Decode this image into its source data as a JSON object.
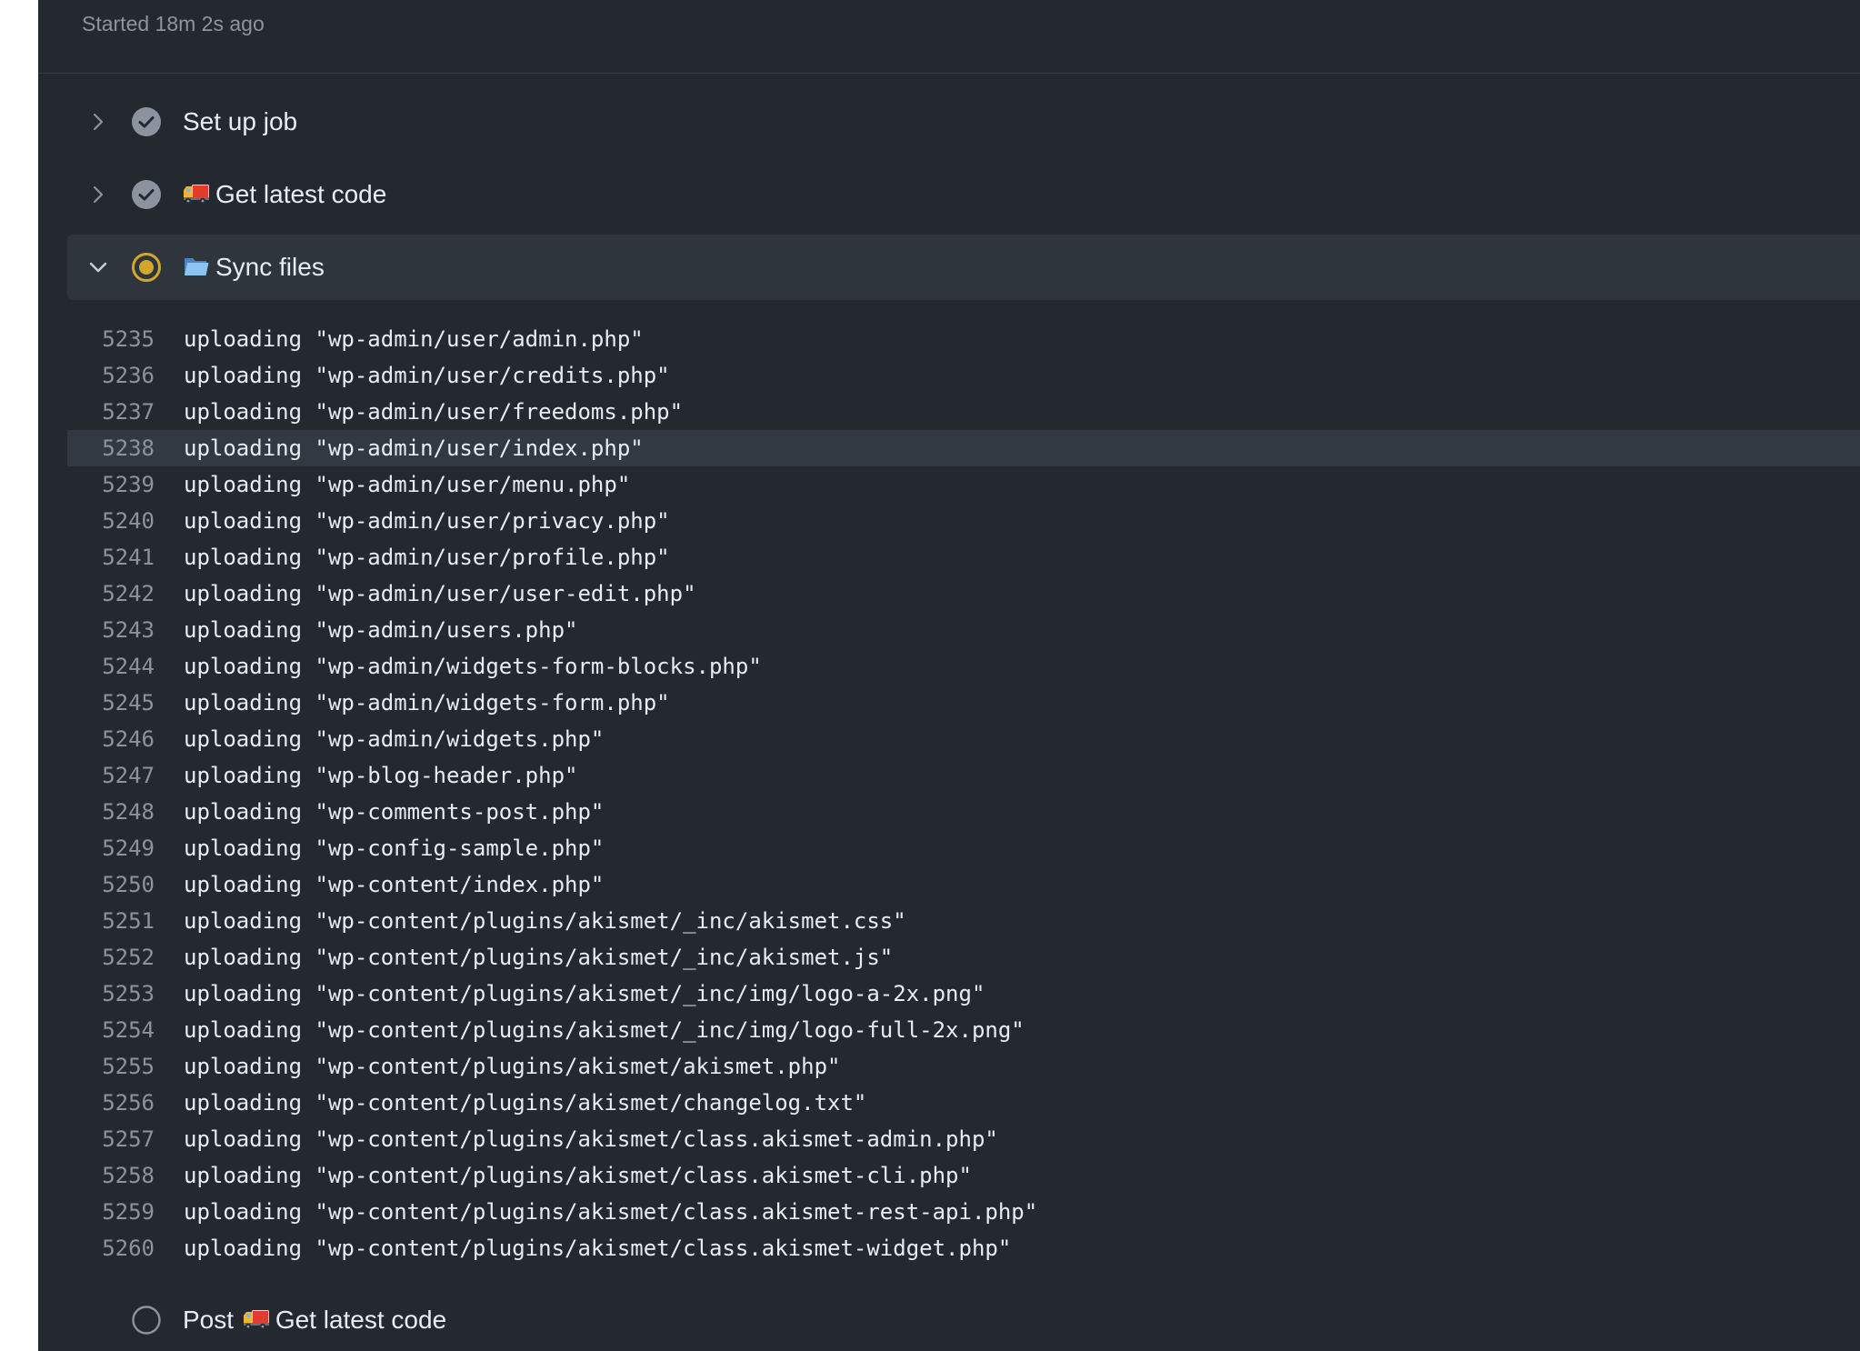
{
  "job": {
    "started": "Started 18m 2s ago"
  },
  "steps": [
    {
      "title": "Set up job",
      "status": "success",
      "expanded": false
    },
    {
      "title": "Get latest code",
      "status": "success",
      "expanded": false,
      "icon": "truck-icon"
    },
    {
      "title": "Sync files",
      "status": "in-progress",
      "expanded": true,
      "icon": "folder-icon"
    },
    {
      "title_prefix": "Post",
      "title": "Get latest code",
      "status": "pending",
      "icon": "truck-icon"
    }
  ],
  "log": {
    "highlighted_line": "5238",
    "lines": [
      {
        "n": "5235",
        "text": "uploading \"wp-admin/user/admin.php\""
      },
      {
        "n": "5236",
        "text": "uploading \"wp-admin/user/credits.php\""
      },
      {
        "n": "5237",
        "text": "uploading \"wp-admin/user/freedoms.php\""
      },
      {
        "n": "5238",
        "text": "uploading \"wp-admin/user/index.php\""
      },
      {
        "n": "5239",
        "text": "uploading \"wp-admin/user/menu.php\""
      },
      {
        "n": "5240",
        "text": "uploading \"wp-admin/user/privacy.php\""
      },
      {
        "n": "5241",
        "text": "uploading \"wp-admin/user/profile.php\""
      },
      {
        "n": "5242",
        "text": "uploading \"wp-admin/user/user-edit.php\""
      },
      {
        "n": "5243",
        "text": "uploading \"wp-admin/users.php\""
      },
      {
        "n": "5244",
        "text": "uploading \"wp-admin/widgets-form-blocks.php\""
      },
      {
        "n": "5245",
        "text": "uploading \"wp-admin/widgets-form.php\""
      },
      {
        "n": "5246",
        "text": "uploading \"wp-admin/widgets.php\""
      },
      {
        "n": "5247",
        "text": "uploading \"wp-blog-header.php\""
      },
      {
        "n": "5248",
        "text": "uploading \"wp-comments-post.php\""
      },
      {
        "n": "5249",
        "text": "uploading \"wp-config-sample.php\""
      },
      {
        "n": "5250",
        "text": "uploading \"wp-content/index.php\""
      },
      {
        "n": "5251",
        "text": "uploading \"wp-content/plugins/akismet/_inc/akismet.css\""
      },
      {
        "n": "5252",
        "text": "uploading \"wp-content/plugins/akismet/_inc/akismet.js\""
      },
      {
        "n": "5253",
        "text": "uploading \"wp-content/plugins/akismet/_inc/img/logo-a-2x.png\""
      },
      {
        "n": "5254",
        "text": "uploading \"wp-content/plugins/akismet/_inc/img/logo-full-2x.png\""
      },
      {
        "n": "5255",
        "text": "uploading \"wp-content/plugins/akismet/akismet.php\""
      },
      {
        "n": "5256",
        "text": "uploading \"wp-content/plugins/akismet/changelog.txt\""
      },
      {
        "n": "5257",
        "text": "uploading \"wp-content/plugins/akismet/class.akismet-admin.php\""
      },
      {
        "n": "5258",
        "text": "uploading \"wp-content/plugins/akismet/class.akismet-cli.php\""
      },
      {
        "n": "5259",
        "text": "uploading \"wp-content/plugins/akismet/class.akismet-rest-api.php\""
      },
      {
        "n": "5260",
        "text": "uploading \"wp-content/plugins/akismet/class.akismet-widget.php\""
      }
    ]
  },
  "colors": {
    "panel_bg": "#24292f",
    "success_gray": "#8b949e",
    "in_progress_yellow": "#d4a72c",
    "text": "#e6edf3"
  }
}
